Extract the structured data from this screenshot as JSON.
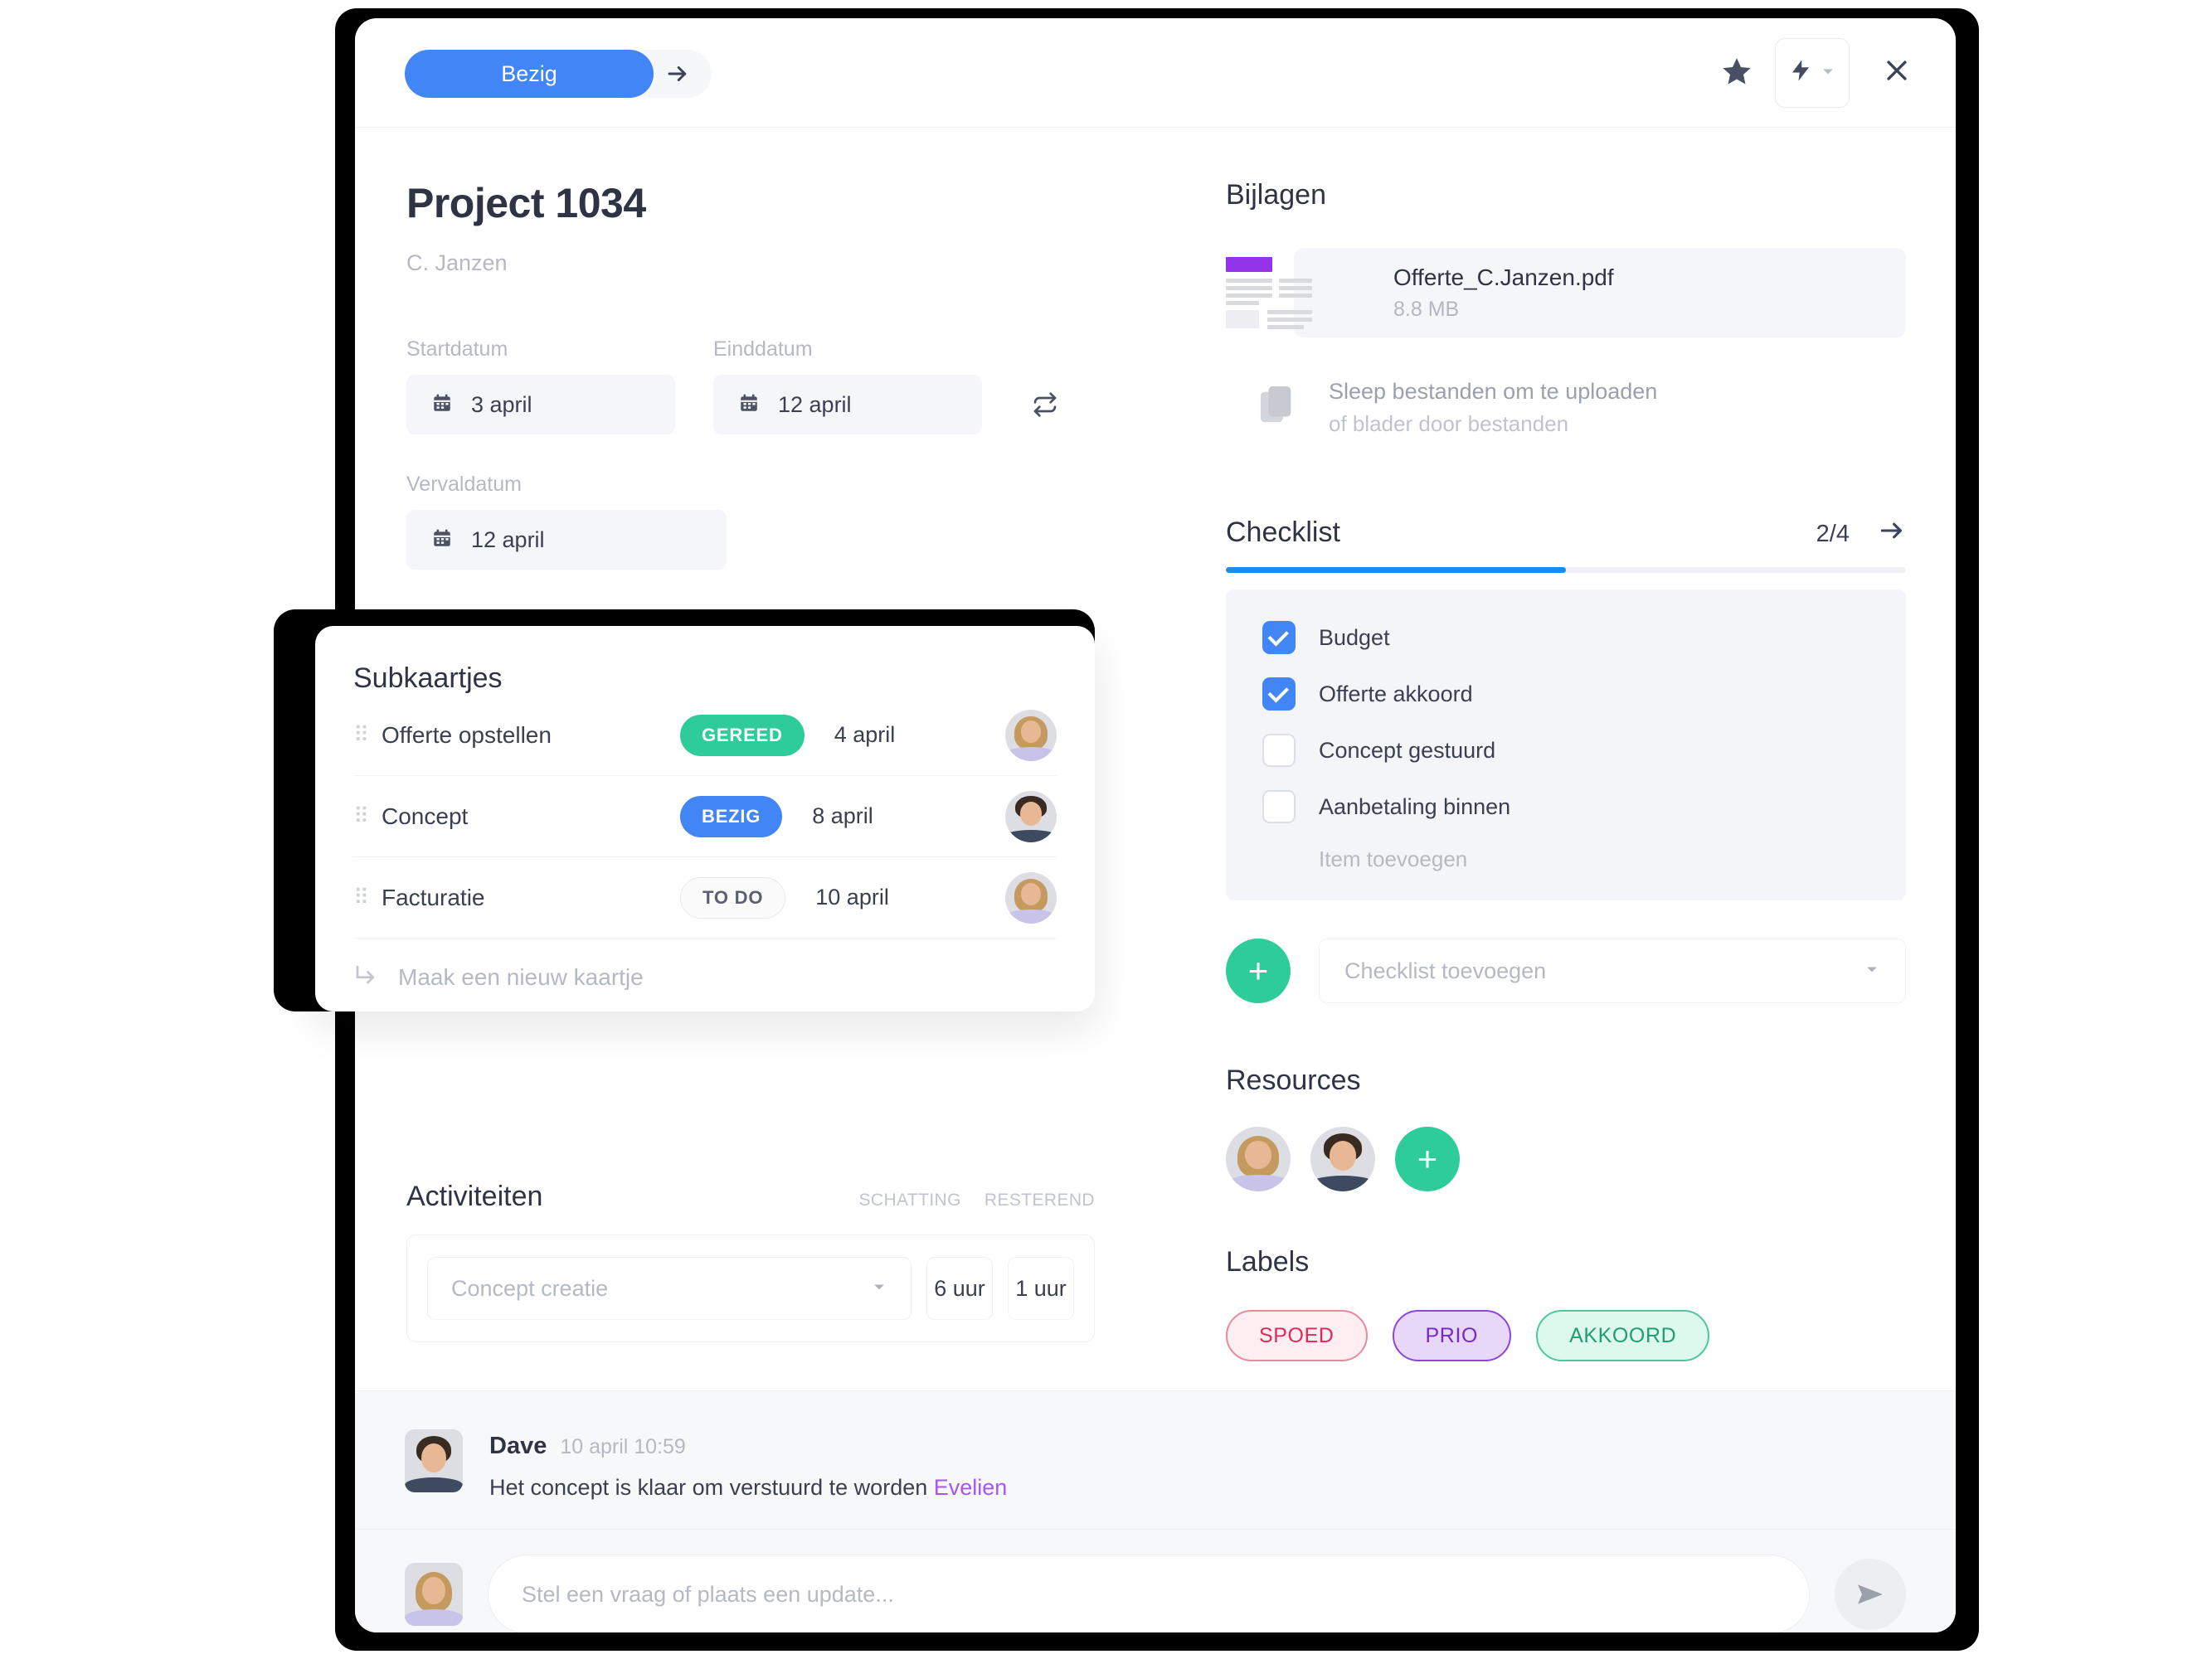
{
  "header": {
    "status_label": "Bezig",
    "next_arrow_icon": "arrow-right-icon",
    "star_icon": "star-icon",
    "lightning_icon": "lightning-bolt-icon",
    "lightning_caret_icon": "chevron-down-icon",
    "close_icon": "close-icon"
  },
  "project": {
    "title": "Project 1034",
    "client": "C. Janzen",
    "start_label": "Startdatum",
    "start_value": "3 april",
    "end_label": "Einddatum",
    "end_value": "12 april",
    "due_label": "Vervaldatum",
    "due_value": "12 april",
    "swap_icon": "swap-dates-icon",
    "calendar_icon": "calendar-icon"
  },
  "subcards": {
    "title": "Subkaartjes",
    "new_card_label": "Maak een nieuw kaartje",
    "rows": [
      {
        "name": "Offerte opstellen",
        "status": "GEREED",
        "date": "4 april",
        "avatar": "female"
      },
      {
        "name": "Concept",
        "status": "BEZIG",
        "date": "8 april",
        "avatar": "male"
      },
      {
        "name": "Facturatie",
        "status": "TO DO",
        "date": "10 april",
        "avatar": "female"
      }
    ]
  },
  "activities": {
    "title": "Activiteiten",
    "col_estimate": "SCHATTING",
    "col_remaining": "RESTEREND",
    "row": {
      "name": "Concept creatie",
      "estimate": "6 uur",
      "remaining": "1 uur"
    }
  },
  "attachments": {
    "title": "Bijlagen",
    "file_name": "Offerte_C.Janzen.pdf",
    "file_size": "8.8 MB",
    "drop_title": "Sleep bestanden om te uploaden",
    "drop_subtitle": "of blader door bestanden",
    "drop_icon": "documents-icon"
  },
  "checklist": {
    "title": "Checklist",
    "count": "2/4",
    "arrow_icon": "arrow-right-icon",
    "progress_percent": 50,
    "items": [
      {
        "label": "Budget",
        "checked": true
      },
      {
        "label": "Offerte akkoord",
        "checked": true
      },
      {
        "label": "Concept gestuurd",
        "checked": false
      },
      {
        "label": "Aanbetaling binnen",
        "checked": false
      }
    ],
    "add_item_label": "Item toevoegen",
    "add_button_icon": "plus-icon",
    "add_select_placeholder": "Checklist toevoegen"
  },
  "resources": {
    "title": "Resources",
    "members": [
      "female",
      "male"
    ],
    "add_button_icon": "plus-icon"
  },
  "labels": {
    "title": "Labels",
    "chips": [
      {
        "text": "SPOED",
        "bg": "#fdeef1",
        "border": "#e8899d",
        "color": "#e0285a"
      },
      {
        "text": "PRIO",
        "bg": "#e7d8fa",
        "border": "#8b46d9",
        "color": "#7828c8"
      },
      {
        "text": "AKKOORD",
        "bg": "#ddf8ec",
        "border": "#4ec79b",
        "color": "#1f9e72"
      }
    ]
  },
  "comment": {
    "author": "Dave",
    "time": "10 april 10:59",
    "text": "Het concept is klaar om verstuurd te worden ",
    "mention": "Evelien"
  },
  "composer": {
    "placeholder": "Stel een vraag of plaats een update...",
    "send_icon": "send-icon"
  },
  "colors": {
    "accent_blue": "#4285f4",
    "progress_blue": "#1a8cf0",
    "green": "#2ecc99",
    "mention_purple": "#a855f7"
  }
}
